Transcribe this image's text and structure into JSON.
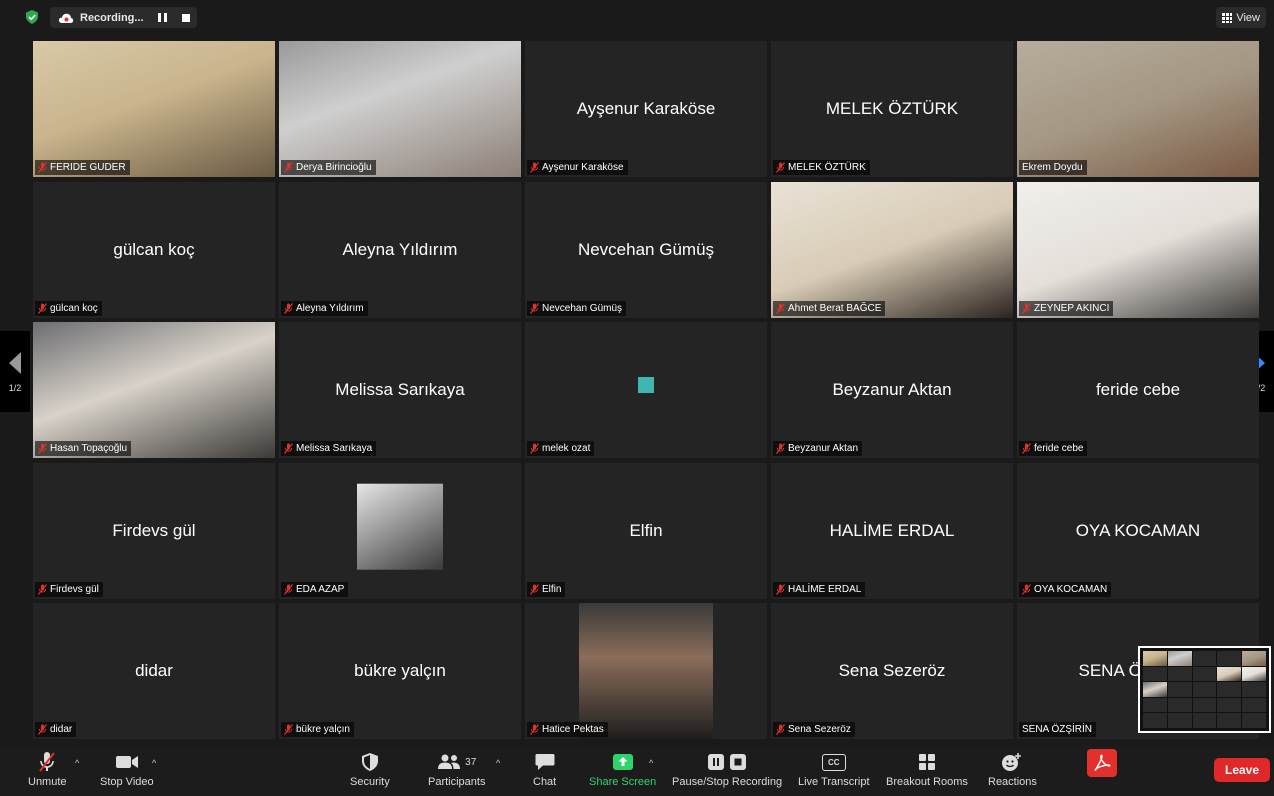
{
  "topbar": {
    "recording_label": "Recording...",
    "view_label": "View"
  },
  "tiles": [
    {
      "name": "FERIDE GUDER",
      "big": "",
      "has_video": true
    },
    {
      "name": "Derya Birincioğlu",
      "big": "",
      "has_video": true
    },
    {
      "name": "Ayşenur Karaköse",
      "big": "Ayşenur Karaköse",
      "has_video": false
    },
    {
      "name": "MELEK ÖZTÜRK",
      "big": "MELEK ÖZTÜRK",
      "has_video": false
    },
    {
      "name": "Ekrem Doydu",
      "big": "",
      "has_video": true,
      "active": true
    },
    {
      "name": "gülcan koç",
      "big": "gülcan koç",
      "has_video": false
    },
    {
      "name": "Aleyna Yıldırım",
      "big": "Aleyna Yıldırım",
      "has_video": false
    },
    {
      "name": "Nevcehan Gümüş",
      "big": "Nevcehan Gümüş",
      "has_video": false
    },
    {
      "name": "Ahmet Berat BAĞCE",
      "big": "",
      "has_video": true
    },
    {
      "name": "ZEYNEP AKINCI",
      "big": "",
      "has_video": true
    },
    {
      "name": "Hasan Topaçoğlu",
      "big": "",
      "has_video": true
    },
    {
      "name": "Melissa Sarıkaya",
      "big": "Melissa Sarıkaya",
      "has_video": false
    },
    {
      "name": "melek ozat",
      "big": "",
      "has_video": false
    },
    {
      "name": "Beyzanur Aktan",
      "big": "Beyzanur Aktan",
      "has_video": false
    },
    {
      "name": "feride cebe",
      "big": "feride cebe",
      "has_video": false
    },
    {
      "name": "Firdevs gül",
      "big": "Firdevs gül",
      "has_video": false
    },
    {
      "name": "EDA AZAP",
      "big": "",
      "has_video": false
    },
    {
      "name": "Elfin",
      "big": "Elfin",
      "has_video": false
    },
    {
      "name": "HALİME ERDAL",
      "big": "HALİME ERDAL",
      "has_video": false
    },
    {
      "name": "OYA KOCAMAN",
      "big": "OYA KOCAMAN",
      "has_video": false
    },
    {
      "name": "didar",
      "big": "didar",
      "has_video": false
    },
    {
      "name": "bükre yalçın",
      "big": "bükre yalçın",
      "has_video": false
    },
    {
      "name": "Hatice Pektas",
      "big": "",
      "has_video": false
    },
    {
      "name": "Sena Sezeröz",
      "big": "Sena Sezeröz",
      "has_video": false
    },
    {
      "name": "SENA ÖZŞİRİN",
      "big": "SENA ÖZŞİRİN",
      "has_video": false,
      "unmuted": true
    }
  ],
  "pager": {
    "left": "1/2",
    "right": "1/2"
  },
  "toolbar": {
    "unmute": "Unmute",
    "stop_video": "Stop Video",
    "security": "Security",
    "participants": "Participants",
    "participant_count": "37",
    "chat": "Chat",
    "share_screen": "Share Screen",
    "pause_stop_recording": "Pause/Stop Recording",
    "live_transcript": "Live Transcript",
    "live_transcript_badge": "CC",
    "breakout_rooms": "Breakout Rooms",
    "reactions": "Reactions",
    "leave": "Leave"
  },
  "colors": {
    "active_speaker": "#e5ea86",
    "share_green": "#2ed36b",
    "leave_red": "#e02828",
    "mute_red": "#e0312c"
  }
}
